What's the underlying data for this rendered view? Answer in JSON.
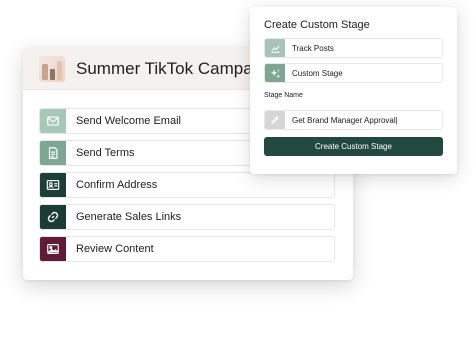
{
  "campaign": {
    "title": "Summer TikTok Campaign",
    "stages": [
      {
        "label": "Send Welcome Email",
        "icon": "mail-icon",
        "color": "#a6c8b7"
      },
      {
        "label": "Send Terms",
        "icon": "document-icon",
        "color": "#7fa693"
      },
      {
        "label": "Confirm Address",
        "icon": "address-card-icon",
        "color": "#1e3f38"
      },
      {
        "label": "Generate Sales Links",
        "icon": "link-icon",
        "color": "#1d3b35"
      },
      {
        "label": "Review Content",
        "icon": "image-icon",
        "color": "#5e1c37"
      }
    ]
  },
  "create_stage": {
    "title": "Create Custom Stage",
    "options": [
      {
        "label": "Track Posts",
        "icon": "chart-icon",
        "color": "#a8c4b5"
      },
      {
        "label": "Custom Stage",
        "icon": "sparkle-icon",
        "color": "#7fa693"
      }
    ],
    "field_label": "Stage Name",
    "field_value": "Get Brand Manager Approval|",
    "field_icon": "pencil-icon",
    "field_icon_color": "#d6d6d6",
    "button_label": "Create Custom Stage",
    "button_color": "#234840"
  }
}
